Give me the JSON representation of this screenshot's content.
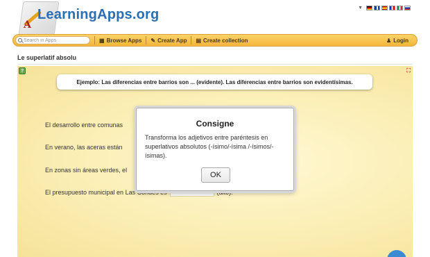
{
  "header": {
    "logo_text": "LearningApps.org",
    "logo_letter": "A",
    "languages": [
      "de",
      "gb",
      "es",
      "fr",
      "it",
      "ru"
    ]
  },
  "nav": {
    "search_placeholder": "Search in Apps",
    "browse_label": "Browse Apps",
    "create_label": "Create App",
    "collection_label": "Create collection",
    "login_label": "Login",
    "icons": {
      "search": "search-icon",
      "browse": "grid-icon",
      "create": "pencil-icon",
      "collection": "collection-icon",
      "login": "user-icon"
    }
  },
  "page": {
    "title": "Le superlatif absolu"
  },
  "exercise": {
    "example": "Ejemplo: Las diferencias entre barrios son ... (evidente). Las diferencias entre barrios son evidentísimas.",
    "sentences": [
      {
        "before": "El desarrollo entre comunas",
        "after": ""
      },
      {
        "before": "En verano, las aceras están",
        "after": ""
      },
      {
        "before": "En zonas sin áreas verdes, el",
        "after": ""
      },
      {
        "before": "El presupuesto municipal en Las Condes es",
        "after": "(alto)."
      }
    ]
  },
  "modal": {
    "title": "Consigne",
    "body": "Transforma los adjetivos entre paréntesis en superlativos absolutos (-ísimo/-ísima /-ísimos/-ísimas).",
    "ok_label": "OK"
  },
  "colors": {
    "brand": "#2a6fb3",
    "navbar": "#f2b63a",
    "app_background": "#fbeeb4"
  }
}
